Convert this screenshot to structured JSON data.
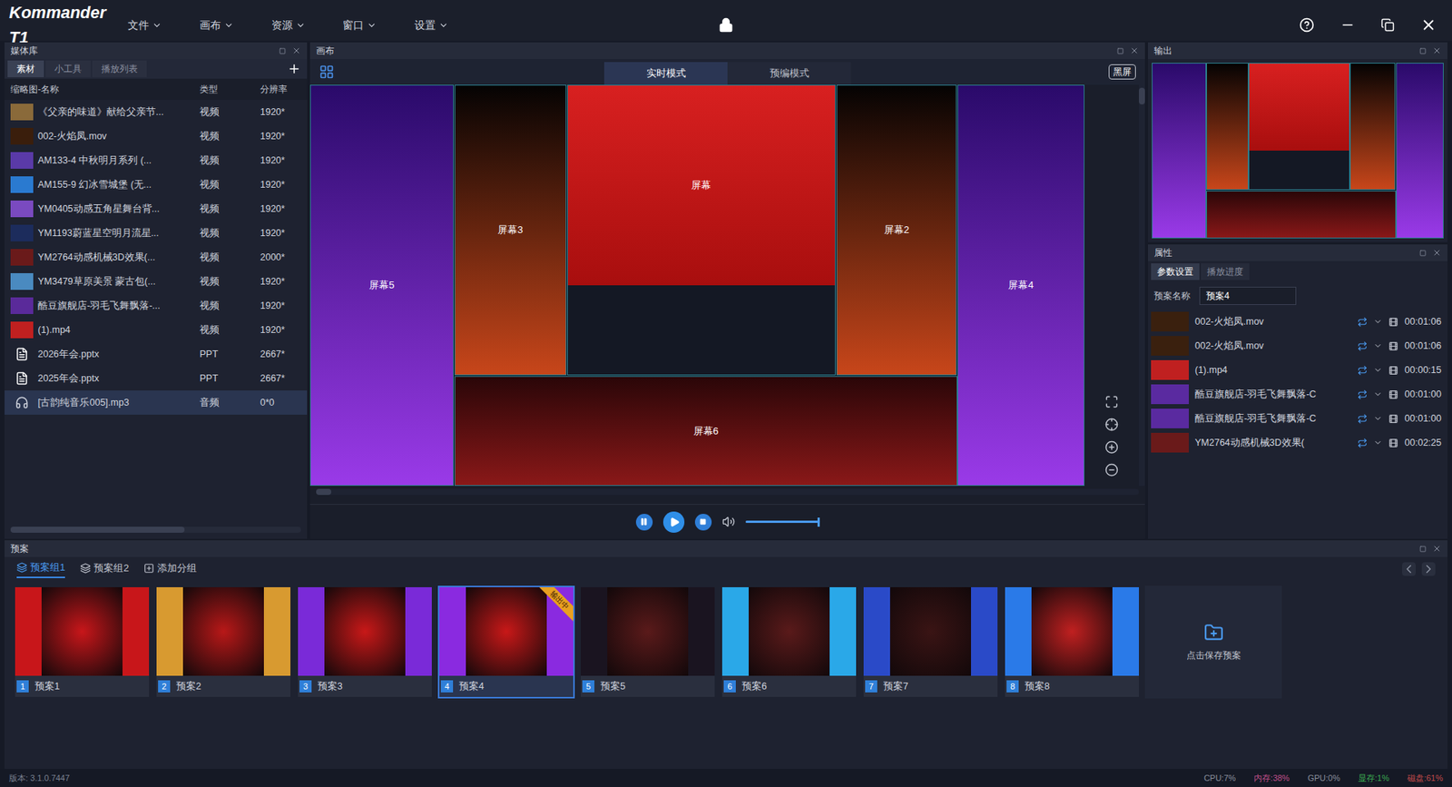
{
  "title_bar": {
    "logo": "Kommander T1",
    "menus": [
      "文件",
      "画布",
      "资源",
      "窗口",
      "设置"
    ]
  },
  "media_library": {
    "title": "媒体库",
    "tabs": [
      {
        "label": "素材",
        "selected": true
      },
      {
        "label": "小工具",
        "selected": false
      },
      {
        "label": "播放列表",
        "selected": false
      }
    ],
    "columns": [
      "缩略图-名称",
      "类型",
      "分辨率"
    ],
    "rows": [
      {
        "name": "《父亲的味道》献给父亲节...",
        "type": "视频",
        "resolution": "1920*",
        "kind": "video",
        "color": "#8a6a3a",
        "selected": false
      },
      {
        "name": "002-火焰凤.mov",
        "type": "视频",
        "resolution": "1920*",
        "kind": "video",
        "color": "#3a1e0c",
        "selected": false
      },
      {
        "name": "AM133-4 中秋明月系列 (...",
        "type": "视频",
        "resolution": "1920*",
        "kind": "video",
        "color": "#5a3aa8",
        "selected": false
      },
      {
        "name": "AM155-9 幻冰雪城堡 (无...",
        "type": "视频",
        "resolution": "1920*",
        "kind": "video",
        "color": "#2a7ad0",
        "selected": false
      },
      {
        "name": "YM0405动感五角星舞台背...",
        "type": "视频",
        "resolution": "1920*",
        "kind": "video",
        "color": "#7a4ac0",
        "selected": false
      },
      {
        "name": "YM1193蔚蓝星空明月流星...",
        "type": "视频",
        "resolution": "1920*",
        "kind": "video",
        "color": "#1c2c5c",
        "selected": false
      },
      {
        "name": "YM2764动感机械3D效果(...",
        "type": "视频",
        "resolution": "2000*",
        "kind": "video",
        "color": "#6a1a1a",
        "selected": false
      },
      {
        "name": "YM3479草原美景 蒙古包(...",
        "type": "视频",
        "resolution": "1920*",
        "kind": "video",
        "color": "#4a8ac0",
        "selected": false
      },
      {
        "name": "酷豆旗舰店-羽毛飞舞飘落-...",
        "type": "视频",
        "resolution": "1920*",
        "kind": "video",
        "color": "#5a2a9a",
        "selected": false
      },
      {
        "name": "(1).mp4",
        "type": "视频",
        "resolution": "1920*",
        "kind": "video",
        "color": "#c02020",
        "selected": false
      },
      {
        "name": "2026年会.pptx",
        "type": "PPT",
        "resolution": "2667*",
        "kind": "ppt",
        "color": "#ffffff",
        "selected": false
      },
      {
        "name": "2025年会.pptx",
        "type": "PPT",
        "resolution": "2667*",
        "kind": "ppt",
        "color": "#ffffff",
        "selected": false
      },
      {
        "name": "[古韵纯音乐005].mp3",
        "type": "音频",
        "resolution": "0*0",
        "kind": "audio",
        "color": "#d0d4de",
        "selected": true
      }
    ]
  },
  "canvas": {
    "title": "画布",
    "modes": [
      {
        "label": "实时模式",
        "selected": true
      },
      {
        "label": "预编模式",
        "selected": false
      }
    ],
    "blackout": "黑屏",
    "screens": [
      {
        "label": "屏幕5",
        "kind": "full",
        "color": "#9a3ae8",
        "shade": "#2a0a6a"
      },
      {
        "label": "屏幕3",
        "kind": "full",
        "color": "#c8461a",
        "shade": "#050303"
      },
      {
        "label": "屏幕",
        "kind": "top-image",
        "color": "#a80e0e",
        "shade": "#d82020"
      },
      {
        "label": "屏幕2",
        "kind": "full",
        "color": "#c8461a",
        "shade": "#050303"
      },
      {
        "label": "屏幕4",
        "kind": "full",
        "color": "#9a3ae8",
        "shade": "#2a0a6a"
      },
      {
        "label": "屏幕6",
        "kind": "full",
        "color": "#8a1818",
        "shade": "#2a0608"
      }
    ]
  },
  "playback": {
    "volume_level": 1
  },
  "output": {
    "title": "输出"
  },
  "properties": {
    "title": "属性",
    "tabs": [
      {
        "label": "参数设置",
        "selected": true
      },
      {
        "label": "播放进度",
        "selected": false
      }
    ],
    "name_label": "预案名称",
    "name_value": "预案4",
    "items": [
      {
        "name": "002-火焰凤.mov",
        "duration": "00:01:06",
        "color": "#3a200e"
      },
      {
        "name": "002-火焰凤.mov",
        "duration": "00:01:06",
        "color": "#3a200e"
      },
      {
        "name": "(1).mp4",
        "duration": "00:00:15",
        "color": "#c02020"
      },
      {
        "name": "酷豆旗舰店-羽毛飞舞飘落-C",
        "duration": "00:01:00",
        "color": "#5a2aa0"
      },
      {
        "name": "酷豆旗舰店-羽毛飞舞飘落-C",
        "duration": "00:01:00",
        "color": "#5a2aa0"
      },
      {
        "name": "YM2764动感机械3D效果(",
        "duration": "00:02:25",
        "color": "#6a1a1a"
      }
    ]
  },
  "presets": {
    "title": "预案",
    "groups": [
      {
        "label": "预案组1",
        "selected": true
      },
      {
        "label": "预案组2",
        "selected": false
      }
    ],
    "add_group": "添加分组",
    "output_badge": "输出中",
    "cards": [
      {
        "number": "1",
        "name": "预案1",
        "color": "#c8161a",
        "side": "#c8161a",
        "selected": false,
        "outputting": false
      },
      {
        "number": "2",
        "name": "预案2",
        "color": "#b81818",
        "side": "#d89a30",
        "selected": false,
        "outputting": false
      },
      {
        "number": "3",
        "name": "预案3",
        "color": "#c81818",
        "side": "#7a2ad8",
        "selected": false,
        "outputting": false
      },
      {
        "number": "4",
        "name": "预案4",
        "color": "#c81818",
        "side": "#8a2ae0",
        "selected": true,
        "outputting": true
      },
      {
        "number": "5",
        "name": "预案5",
        "color": "#5a1a1a",
        "side": "#1a1420",
        "selected": false,
        "outputting": false
      },
      {
        "number": "6",
        "name": "预案6",
        "color": "#5a1a1a",
        "side": "#2aa8e8",
        "selected": false,
        "outputting": false
      },
      {
        "number": "7",
        "name": "预案7",
        "color": "#3a1414",
        "side": "#2a4ac8",
        "selected": false,
        "outputting": false
      },
      {
        "number": "8",
        "name": "预案8",
        "color": "#c02020",
        "side": "#2a7ae8",
        "selected": false,
        "outputting": false
      }
    ],
    "save_card": "点击保存预案"
  },
  "status_bar": {
    "version": "版本: 3.1.0.7447",
    "metrics": [
      {
        "label": "CPU:7%",
        "color": "#8a8f9c"
      },
      {
        "label": "内存:38%",
        "color": "#c0508a"
      },
      {
        "label": "GPU:0%",
        "color": "#8a8f9c"
      },
      {
        "label": "显存:1%",
        "color": "#3aa850"
      },
      {
        "label": "磁盘:61%",
        "color": "#c04a4a"
      }
    ]
  }
}
